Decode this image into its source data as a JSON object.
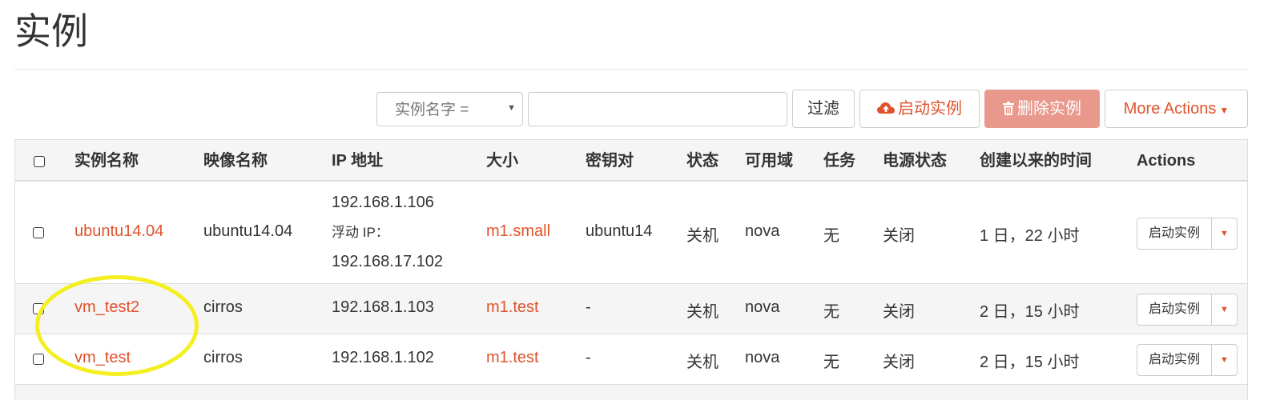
{
  "page": {
    "title": "实例"
  },
  "toolbar": {
    "filter_select": "实例名字 =",
    "filter_input_value": "",
    "filter_button": "过滤",
    "launch_button": "启动实例",
    "delete_button": "删除实例",
    "more_button": "More Actions"
  },
  "table": {
    "headers": {
      "name": "实例名称",
      "image": "映像名称",
      "ip": "IP 地址",
      "size": "大小",
      "keypair": "密钥对",
      "status": "状态",
      "az": "可用域",
      "task": "任务",
      "power": "电源状态",
      "age": "创建以来的时间",
      "actions": "Actions"
    },
    "rows": [
      {
        "name": "ubuntu14.04",
        "image": "ubuntu14.04",
        "ip_fixed": "192.168.1.106",
        "ip_floating_label": "浮动 IP：",
        "ip_floating": "192.168.17.102",
        "size": "m1.small",
        "keypair": "ubuntu14",
        "status": "关机",
        "az": "nova",
        "task": "无",
        "power": "关闭",
        "age": "1 日，22 小时",
        "action": "启动实例"
      },
      {
        "name": "vm_test2",
        "image": "cirros",
        "ip_fixed": "192.168.1.103",
        "size": "m1.test",
        "keypair": "-",
        "status": "关机",
        "az": "nova",
        "task": "无",
        "power": "关闭",
        "age": "2 日，15 小时",
        "action": "启动实例"
      },
      {
        "name": "vm_test",
        "image": "cirros",
        "ip_fixed": "192.168.1.102",
        "size": "m1.test",
        "keypair": "-",
        "status": "关机",
        "az": "nova",
        "task": "无",
        "power": "关闭",
        "age": "2 日，15 小时",
        "action": "启动实例"
      }
    ]
  },
  "colors": {
    "accent": "#e0522c",
    "danger_disabled": "#e8998c",
    "annotation": "#f3ef22"
  },
  "icons": {
    "launch": "cloud-upload-icon",
    "delete": "trash-icon",
    "more": "caret-down-icon",
    "row_action": "caret-down-icon"
  }
}
